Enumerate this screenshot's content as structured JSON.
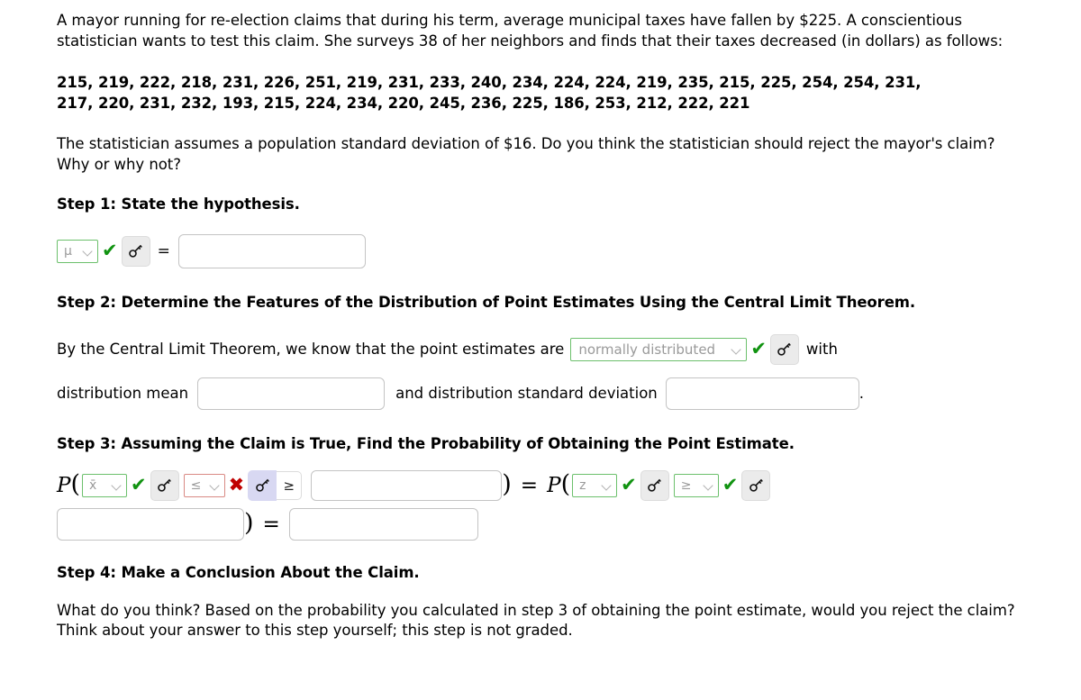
{
  "problem": {
    "intro": "A mayor running for re-election claims that during his term, average municipal taxes have fallen by $225. A conscientious statistician wants to test this claim. She surveys 38 of her neighbors and finds that their taxes decreased (in dollars) as follows:",
    "data_line_1": "215, 219, 222, 218, 231, 226, 251, 219, 231, 233, 240, 234, 224, 224, 219, 235, 215, 225, 254, 254, 231,",
    "data_line_2": "217, 220, 231, 232, 193, 215, 224, 234, 220, 245, 236, 225, 186, 253, 212, 222, 221",
    "question": "The statistician assumes a population standard deviation of $16. Do you think the statistician should reject the mayor's claim? Why or why not?"
  },
  "step1": {
    "heading": "Step 1: State the hypothesis.",
    "param_select_value": "μ",
    "check_mark": "✔",
    "key_icon": "key-icon",
    "equals": "=",
    "hypothesis_input_value": ""
  },
  "step2": {
    "heading": "Step 2: Determine the Features of the Distribution of Point Estimates Using the Central Limit Theorem.",
    "lead_text": "By the Central Limit Theorem, we know that the point estimates are",
    "distribution_select_value": "normally distributed",
    "check_mark": "✔",
    "with_text": "with",
    "mean_label": "distribution mean",
    "mean_input_value": "",
    "sd_label": "and distribution standard deviation",
    "sd_input_value": "",
    "trailing_period": "."
  },
  "step3": {
    "heading": "Step 3: Assuming the Claim is True, Find the Probability of Obtaining the Point Estimate.",
    "p_label": "P",
    "open_paren": "(",
    "close_paren": ")",
    "equals": "=",
    "statistic_select_value": "x̄",
    "statistic_check": "✔",
    "inequality_select_value": "≤",
    "inequality_cross": "✖",
    "operator_box_value": "≥",
    "value_input_1": "",
    "z_select_value": "z",
    "z_check": "✔",
    "z_inequality_select_value": "≥",
    "z_inequality_check": "✔",
    "value_input_2": "",
    "value_input_3": ""
  },
  "step4": {
    "heading": "Step 4: Make a Conclusion About the Claim.",
    "body": "What do you think? Based on the probability you calculated in step 3 of obtaining the point estimate, would you reject the claim? Think about your answer to this step yourself; this step is not graded."
  },
  "colors": {
    "valid_green": "#119311",
    "invalid_red": "#c00000",
    "select_green_border": "#6cc06c",
    "select_red_border": "#d98a84",
    "key_button_bg": "#ebebeb",
    "key_button_active_bg": "#d8d8f2"
  }
}
